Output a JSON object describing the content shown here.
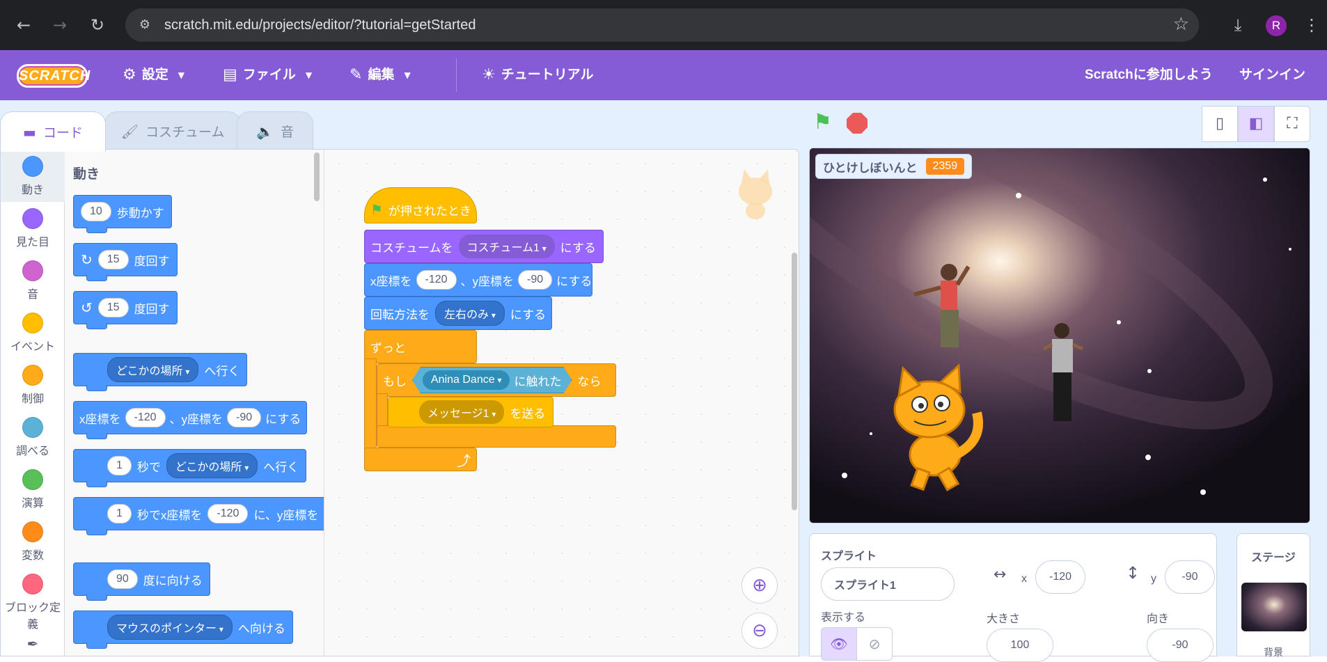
{
  "browser": {
    "url": "scratch.mit.edu/projects/editor/?tutorial=getStarted",
    "avatar_letter": "R"
  },
  "menubar": {
    "logo": "SCRATCH",
    "settings": "設定",
    "file": "ファイル",
    "edit": "編集",
    "tutorial": "チュートリアル",
    "join": "Scratchに参加しよう",
    "signin": "サインイン"
  },
  "tabs": {
    "code": "コード",
    "costume": "コスチューム",
    "sound": "音"
  },
  "categories": [
    {
      "label": "動き",
      "color": "#4c97ff"
    },
    {
      "label": "見た目",
      "color": "#9966ff"
    },
    {
      "label": "音",
      "color": "#cf63cf"
    },
    {
      "label": "イベント",
      "color": "#ffbf00"
    },
    {
      "label": "制御",
      "color": "#ffab19"
    },
    {
      "label": "調べる",
      "color": "#5cb1d6"
    },
    {
      "label": "演算",
      "color": "#59c059"
    },
    {
      "label": "変数",
      "color": "#ff8c1a"
    },
    {
      "label": "ブロック定義",
      "color": "#ff6680"
    }
  ],
  "palette": {
    "title": "動き",
    "move": {
      "value": "10",
      "text": "歩動かす"
    },
    "turn_right": {
      "value": "15",
      "text": "度回す"
    },
    "turn_left": {
      "value": "15",
      "text": "度回す"
    },
    "goto": {
      "menu": "どこかの場所",
      "text": "へ行く"
    },
    "gotoxy": {
      "x_label": "x座標を",
      "x": "-120",
      "y_label": "、y座標を",
      "y": "-90",
      "suffix": "にする"
    },
    "glide": {
      "value": "1",
      "mid": "秒で",
      "menu": "どこかの場所",
      "text": "へ行く"
    },
    "glidexy": {
      "value": "1",
      "mid": "秒でx座標を",
      "x": "-120",
      "y_label": "に、y座標を"
    },
    "point": {
      "value": "90",
      "text": "度に向ける"
    },
    "pointtowards": {
      "menu": "マウスのポインター",
      "text": "へ向ける"
    }
  },
  "script": {
    "hat": "が押されたとき",
    "costume": {
      "prefix": "コスチュームを",
      "menu": "コスチューム1",
      "suffix": "にする"
    },
    "gotoxy": {
      "x_label": "x座標を",
      "x": "-120",
      "y_label": "、y座標を",
      "y": "-90",
      "suffix": "にする"
    },
    "rotation": {
      "prefix": "回転方法を",
      "menu": "左右のみ",
      "suffix": "にする"
    },
    "forever": "ずっと",
    "if": {
      "prefix": "もし",
      "sprite": "Anina Dance",
      "touch": "に触れた",
      "suffix": "なら"
    },
    "broadcast": {
      "menu": "メッセージ1",
      "suffix": "を送る"
    },
    "loop_arrow": "⤴"
  },
  "stage": {
    "monitor_label": "ひとけしぼいんと",
    "monitor_value": "2359"
  },
  "sprite_info": {
    "sprite_label": "スプライト",
    "sprite_name": "スプライト1",
    "x_label": "x",
    "x": "-120",
    "y_label": "y",
    "y": "-90",
    "show_label": "表示する",
    "size_label": "大きさ",
    "size": "100",
    "direction_label": "向き",
    "direction": "-90"
  },
  "stage_pane": {
    "title": "ステージ",
    "backdrop_label": "背景"
  }
}
